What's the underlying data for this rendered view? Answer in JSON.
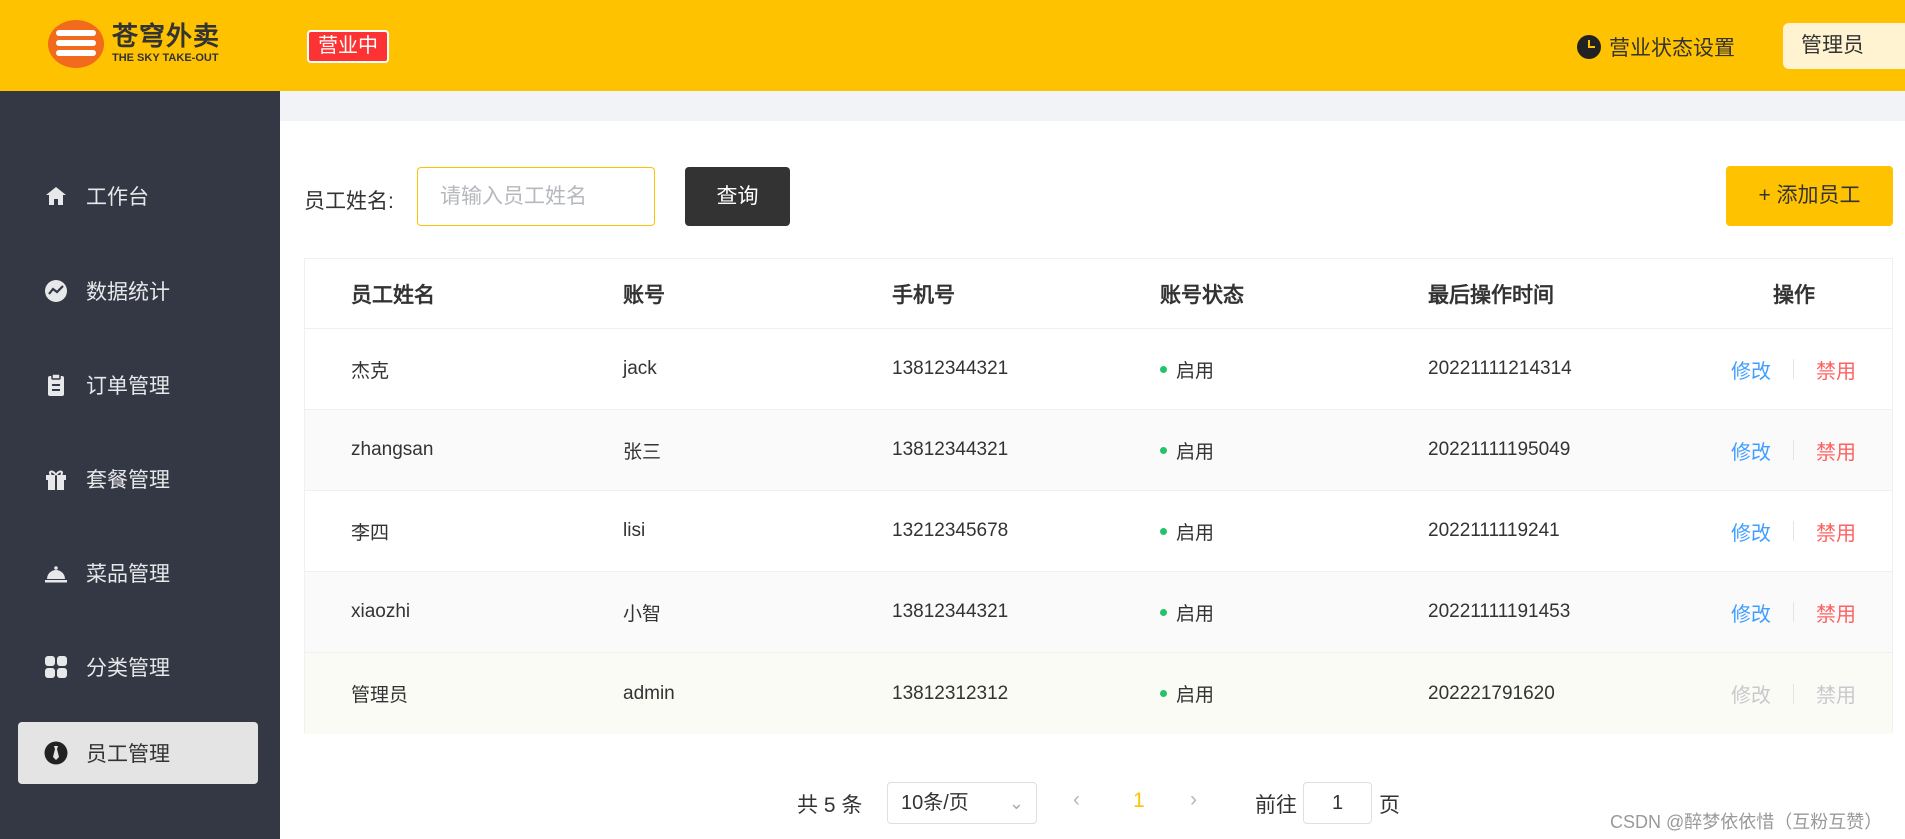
{
  "header": {
    "logo_cn": "苍穹外卖",
    "logo_en": "THE SKY TAKE-OUT",
    "status_badge": "营业中",
    "shop_status_label": "营业状态设置",
    "user_label": "管理员"
  },
  "sidebar": {
    "items": [
      {
        "label": "工作台",
        "icon": "home-icon"
      },
      {
        "label": "数据统计",
        "icon": "chart-icon"
      },
      {
        "label": "订单管理",
        "icon": "clipboard-icon"
      },
      {
        "label": "套餐管理",
        "icon": "gift-icon"
      },
      {
        "label": "菜品管理",
        "icon": "cloche-icon"
      },
      {
        "label": "分类管理",
        "icon": "grid-icon"
      },
      {
        "label": "员工管理",
        "icon": "tie-icon",
        "active": true
      }
    ]
  },
  "search": {
    "label": "员工姓名:",
    "placeholder": "请输入员工姓名",
    "query_label": "查询",
    "add_label": "+ 添加员工"
  },
  "table": {
    "headers": [
      "员工姓名",
      "账号",
      "手机号",
      "账号状态",
      "最后操作时间",
      "操作"
    ],
    "rows": [
      {
        "name": "杰克",
        "account": "jack",
        "phone": "13812344321",
        "status": "启用",
        "time": "20221111214314",
        "edit": "修改",
        "disable": "禁用"
      },
      {
        "name": "zhangsan",
        "account": "张三",
        "phone": "13812344321",
        "status": "启用",
        "time": "20221111195049",
        "edit": "修改",
        "disable": "禁用"
      },
      {
        "name": "李四",
        "account": "lisi",
        "phone": "13212345678",
        "status": "启用",
        "time": "2022111119241",
        "edit": "修改",
        "disable": "禁用"
      },
      {
        "name": "xiaozhi",
        "account": "小智",
        "phone": "13812344321",
        "status": "启用",
        "time": "20221111191453",
        "edit": "修改",
        "disable": "禁用"
      },
      {
        "name": "管理员",
        "account": "admin",
        "phone": "13812312312",
        "status": "启用",
        "time": "202221791620",
        "edit": "修改",
        "disable": "禁用"
      }
    ]
  },
  "pagination": {
    "total": "共 5 条",
    "page_size": "10条/页",
    "current_page": "1",
    "goto_label": "前往",
    "goto_value": "1",
    "goto_suffix": "页"
  },
  "watermark": "CSDN @醉梦依依惜（互粉互赞）",
  "colors": {
    "brand": "#ffc200",
    "sidebar": "#343744",
    "status_badge": "#fd3333",
    "edit_link": "#419eff",
    "disable_link": "#fd6161",
    "status_dot": "#22c36a"
  }
}
